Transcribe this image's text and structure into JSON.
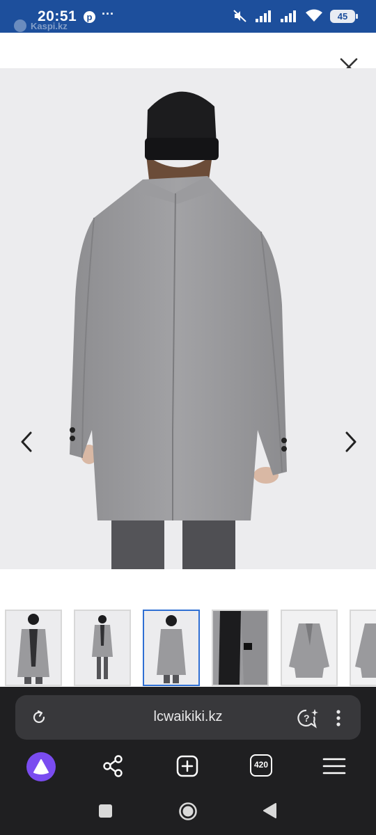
{
  "status": {
    "time": "20:51",
    "watermark": "Kaspi.kz",
    "more": "···",
    "battery": "45"
  },
  "gallery": {
    "product_color": "#9a9a9d",
    "thumbnails": [
      {
        "name": "thumb-front-open",
        "active": false
      },
      {
        "name": "thumb-full-front",
        "active": false
      },
      {
        "name": "thumb-back",
        "active": true
      },
      {
        "name": "thumb-inner-label",
        "active": false
      },
      {
        "name": "thumb-flat-front",
        "active": false
      },
      {
        "name": "thumb-flat-partial",
        "active": false
      }
    ]
  },
  "browser": {
    "url": "lcwaikiki.kz",
    "tabs_count": "420",
    "accent": "#7a4cf0"
  },
  "icons": [
    "close-icon",
    "chevron-left-icon",
    "chevron-right-icon",
    "reload-icon",
    "ai-assistant-icon",
    "kebab-menu-icon",
    "alice-icon",
    "share-icon",
    "new-tab-icon",
    "hamburger-menu-icon",
    "nav-recents-icon",
    "nav-home-icon",
    "nav-back-icon"
  ]
}
